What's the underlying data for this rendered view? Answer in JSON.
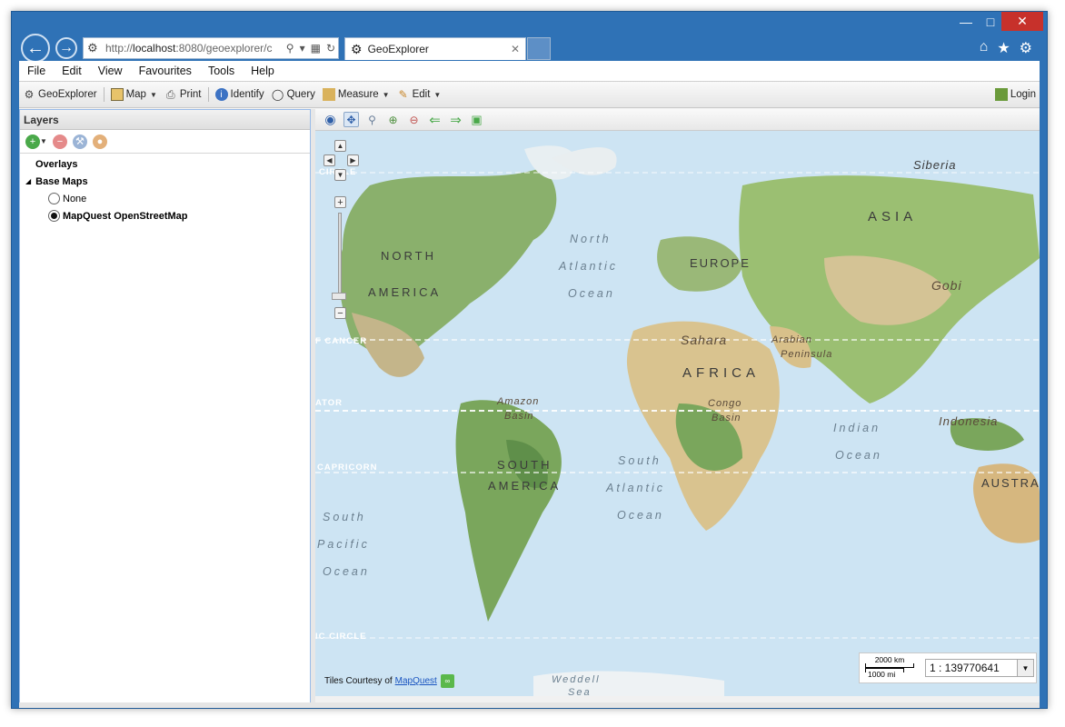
{
  "browser": {
    "address_url_prefix": "http://",
    "address_url_host": "localhost",
    "address_url_rest": ":8080/geoexplorer/c",
    "tab_title": "GeoExplorer",
    "tab_close": "✕"
  },
  "menubar": [
    "File",
    "Edit",
    "View",
    "Favourites",
    "Tools",
    "Help"
  ],
  "toolbar": {
    "app_label": "GeoExplorer",
    "map_label": "Map",
    "print_label": "Print",
    "identify_label": "Identify",
    "query_label": "Query",
    "measure_label": "Measure",
    "edit_label": "Edit",
    "login_label": "Login"
  },
  "layers": {
    "title": "Layers",
    "overlays": "Overlays",
    "base_maps": "Base Maps",
    "options": [
      {
        "label": "None",
        "selected": false
      },
      {
        "label": "MapQuest OpenStreetMap",
        "selected": true
      }
    ]
  },
  "map": {
    "labels": {
      "siberia": "Siberia",
      "asia": "ASIA",
      "north_america_1": "NORTH",
      "north_america_2": "AMERICA",
      "north_atlantic_1": "North",
      "north_atlantic_2": "Atlantic",
      "north_atlantic_3": "Ocean",
      "europe": "EUROPE",
      "gobi": "Gobi",
      "sahara": "Sahara",
      "arabian_1": "Arabian",
      "arabian_2": "Peninsula",
      "africa": "AFRICA",
      "amazon_1": "Amazon",
      "amazon_2": "Basin",
      "congo_1": "Congo",
      "congo_2": "Basin",
      "indian_1": "Indian",
      "indian_2": "Ocean",
      "indonesia": "Indonesia",
      "south_america_1": "SOUTH",
      "south_america_2": "AMERICA",
      "south_atlantic_1": "South",
      "south_atlantic_2": "Atlantic",
      "south_atlantic_3": "Ocean",
      "south_pacific_1": "South",
      "south_pacific_2": "Pacific",
      "south_pacific_3": "Ocean",
      "austra": "AUSTRA",
      "weddell": "Weddell",
      "sea": "Sea",
      "circle_top": "CIRCLE",
      "cancer": "F CANCER",
      "equator": "ATOR",
      "capricorn": "CAPRICORN",
      "circle_bottom": "IC CIRCLE"
    },
    "attribution_prefix": "Tiles Courtesy of",
    "attribution_link": "MapQuest",
    "scale_km": "2000 km",
    "scale_mi": "1000 mi",
    "scale_value": "1 : 139770641"
  }
}
